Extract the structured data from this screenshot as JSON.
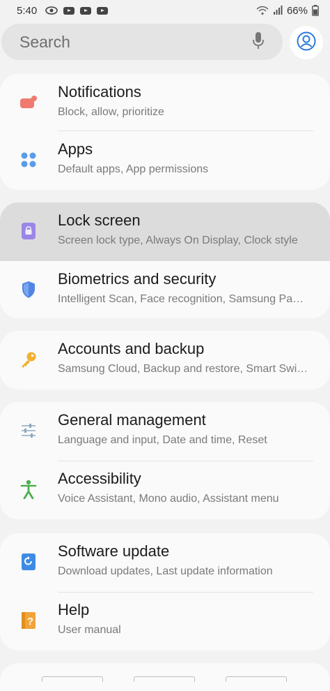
{
  "status": {
    "time": "5:40",
    "battery": "66%",
    "left_icons": [
      "cloud-sync-icon",
      "youtube-icon",
      "youtube-icon",
      "youtube-icon"
    ],
    "right_icons": [
      "wifi-icon",
      "signal-icon",
      "battery-icon"
    ]
  },
  "search": {
    "placeholder": "Search",
    "mic_icon": "mic-icon",
    "profile_icon": "account-icon"
  },
  "groups": [
    {
      "items": [
        {
          "title": "Notifications",
          "subtitle": "Block, allow, prioritize",
          "icon": "notification-icon",
          "color": "#f07a6e"
        },
        {
          "title": "Apps",
          "subtitle": "Default apps, App permissions",
          "icon": "apps-icon",
          "color": "#5b9bea"
        }
      ]
    },
    {
      "items": [
        {
          "title": "Lock screen",
          "subtitle": "Screen lock type, Always On Display, Clock style",
          "icon": "lock-icon",
          "color": "#9b86e8",
          "selected": true
        },
        {
          "title": "Biometrics and security",
          "subtitle": "Intelligent Scan, Face recognition, Samsung Pa…",
          "icon": "shield-icon",
          "color": "#4f86e6"
        }
      ]
    },
    {
      "items": [
        {
          "title": "Accounts and backup",
          "subtitle": "Samsung Cloud, Backup and restore, Smart Swi…",
          "icon": "key-icon",
          "color": "#f2b02e"
        }
      ]
    },
    {
      "items": [
        {
          "title": "General management",
          "subtitle": "Language and input, Date and time, Reset",
          "icon": "sliders-icon",
          "color": "#8fa8bd"
        },
        {
          "title": "Accessibility",
          "subtitle": "Voice Assistant, Mono audio, Assistant menu",
          "icon": "accessibility-icon",
          "color": "#4caf50"
        }
      ]
    },
    {
      "items": [
        {
          "title": "Software update",
          "subtitle": "Download updates, Last update information",
          "icon": "update-icon",
          "color": "#3e8be6"
        },
        {
          "title": "Help",
          "subtitle": "User manual",
          "icon": "help-icon",
          "color": "#f2a33a"
        }
      ]
    }
  ]
}
